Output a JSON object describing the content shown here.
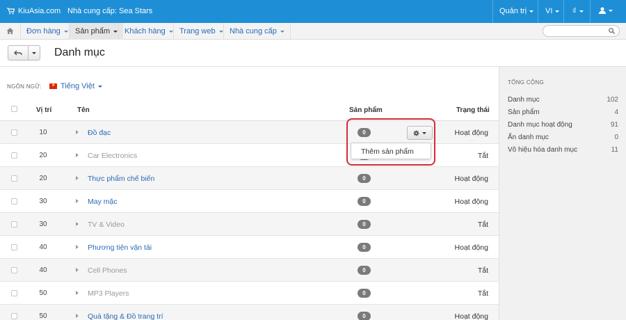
{
  "topbar": {
    "brand": "KiuAsia.com",
    "vendor": "Nhà cung cấp: Sea Stars",
    "admin_menu": "Quản trị",
    "language_menu": "VI",
    "currency_menu": "₫"
  },
  "nav": {
    "items": [
      {
        "label": "Đơn hàng"
      },
      {
        "label": "Sản phẩm"
      },
      {
        "label": "Khách hàng"
      },
      {
        "label": "Trang web"
      },
      {
        "label": "Nhà cung cấp"
      }
    ],
    "search_placeholder": ""
  },
  "page": {
    "title": "Danh mục"
  },
  "language": {
    "label": "NGÔN NGỮ:",
    "value": "Tiếng Việt"
  },
  "table": {
    "headers": {
      "position": "Vị trí",
      "name": "Tên",
      "products": "Sản phẩm",
      "status": "Trạng thái"
    },
    "rows": [
      {
        "position": "10",
        "name": "Đồ đạc",
        "products": "0",
        "status": "Hoạt động",
        "active": true
      },
      {
        "position": "20",
        "name": "Car Electronics",
        "products": "0",
        "status": "Tắt",
        "active": false
      },
      {
        "position": "20",
        "name": "Thực phẩm chế biến",
        "products": "0",
        "status": "Hoạt động",
        "active": true
      },
      {
        "position": "30",
        "name": "May mặc",
        "products": "0",
        "status": "Hoạt động",
        "active": true
      },
      {
        "position": "30",
        "name": "TV & Video",
        "products": "0",
        "status": "Tắt",
        "active": false
      },
      {
        "position": "40",
        "name": "Phương tiện vận tải",
        "products": "0",
        "status": "Hoạt động",
        "active": true
      },
      {
        "position": "40",
        "name": "Cell Phones",
        "products": "0",
        "status": "Tắt",
        "active": false
      },
      {
        "position": "50",
        "name": "MP3 Players",
        "products": "0",
        "status": "Tắt",
        "active": false
      },
      {
        "position": "50",
        "name": "Quà tặng & Đồ trang trí",
        "products": "0",
        "status": "Hoạt động",
        "active": true
      }
    ]
  },
  "dropdown": {
    "add_product": "Thêm sản phẩm"
  },
  "sidebar": {
    "title": "TỔNG CỘNG",
    "stats": [
      {
        "label": "Danh mục",
        "value": "102"
      },
      {
        "label": "Sản phẩm",
        "value": "4"
      },
      {
        "label": "Danh mục hoạt động",
        "value": "91"
      },
      {
        "label": "Ẩn danh mục",
        "value": "0"
      },
      {
        "label": "Vô hiệu hóa danh mục",
        "value": "11"
      }
    ]
  },
  "colors": {
    "topbar": "#1e8fd6",
    "link": "#2a6ab5",
    "highlight": "#d32b36"
  }
}
